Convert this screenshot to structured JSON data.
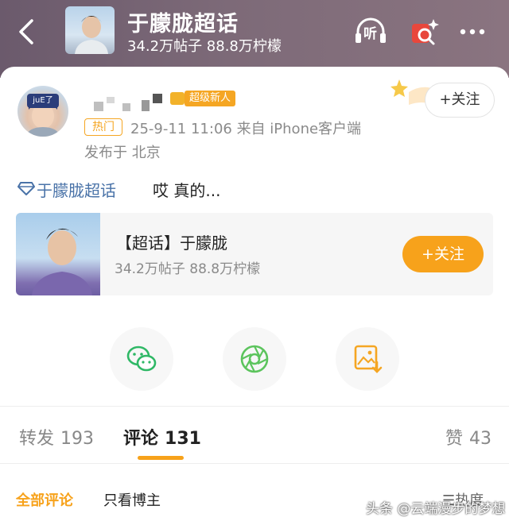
{
  "header": {
    "title": "于朦胧超话",
    "stats": "34.2万帖子 88.8万柠檬",
    "listen_label": "听"
  },
  "post": {
    "newbie_badge": "超级新人",
    "hot_tag": "热门",
    "meta": "25-9-11 11:06  来自 iPhone客户端",
    "location": "发布于 北京",
    "follow_label": "+关注",
    "topic_name": "于朦胧超话",
    "text": "哎 真的...",
    "avatar_tag": "juE了"
  },
  "super_topic": {
    "title": "【超话】于朦胧",
    "stats": "34.2万帖子 88.8万柠檬",
    "follow_label": "+关注"
  },
  "share": {
    "items": [
      "wechat-icon",
      "moments-icon",
      "save-image-icon"
    ],
    "colors": {
      "wechat": "#2fb866",
      "moments": "#5cc45d",
      "save": "#f5a623"
    }
  },
  "tabs": [
    {
      "label": "转发",
      "count": "193"
    },
    {
      "label": "评论",
      "count": "131"
    },
    {
      "label": "赞",
      "count": "43"
    }
  ],
  "filters": {
    "all": "全部评论",
    "author_only": "只看博主",
    "sort": "热度"
  },
  "watermark": "头条 @云端漫步的梦想",
  "colors": {
    "accent": "#f7a21b",
    "link": "#4a73a8"
  }
}
